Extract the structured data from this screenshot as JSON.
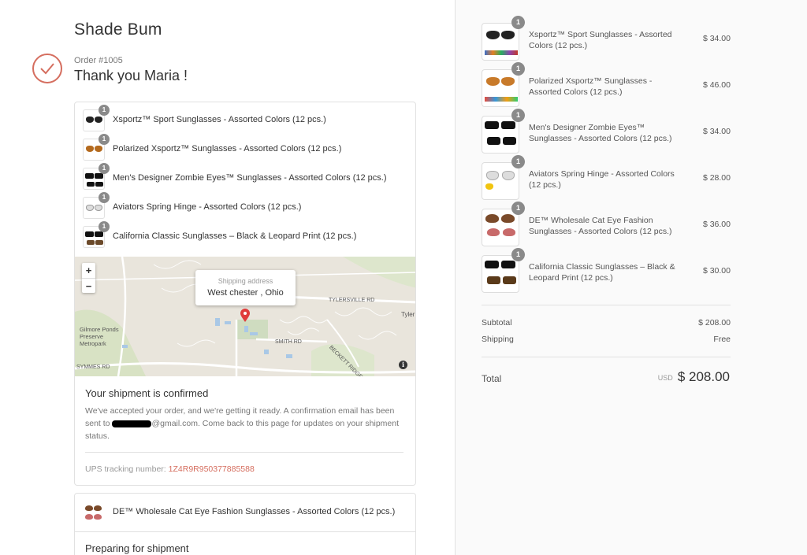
{
  "shop": {
    "name": "Shade Bum"
  },
  "order": {
    "number": "Order #1005",
    "thank_you": "Thank you Maria !"
  },
  "fulfilled_items": [
    {
      "name": "Xsportz™ Sport Sunglasses - Assorted Colors (12 pcs.)",
      "qty": "1"
    },
    {
      "name": "Polarized Xsportz™ Sunglasses - Assorted Colors (12 pcs.)",
      "qty": "1"
    },
    {
      "name": "Men's Designer Zombie Eyes™ Sunglasses - Assorted Colors (12 pcs.)",
      "qty": "1"
    },
    {
      "name": "Aviators Spring Hinge - Assorted Colors (12 pcs.)",
      "qty": "1"
    },
    {
      "name": "California Classic Sunglasses – Black & Leopard Print (12 pcs.)",
      "qty": "1"
    }
  ],
  "map": {
    "zoom_in": "+",
    "zoom_out": "−",
    "popup_label": "Shipping address",
    "popup_address": "West chester , Ohio",
    "info": "i",
    "labels": {
      "park": "Gilmore Ponds\nPreserve\nMetropark",
      "tylersville": "TYLERSVILLE RD",
      "tyler": "Tyler",
      "smith": "SMITH RD",
      "beckett": "BECKETT RIDGE BLVD",
      "symmes": "SYMMES RD"
    }
  },
  "shipment": {
    "title": "Your shipment is confirmed",
    "text_before": "We've accepted your order, and we're getting it ready. A confirmation email has been sent to ",
    "email_suffix": "@gmail.com",
    "text_after": ". Come back to this page for updates on your shipment status.",
    "tracking_label": "UPS tracking number: ",
    "tracking_number": "1Z4R9R950377885588"
  },
  "pending": {
    "item": {
      "name": "DE™ Wholesale Cat Eye Fashion Sunglasses - Assorted Colors (12 pcs.)",
      "qty": "1"
    },
    "title": "Preparing for shipment"
  },
  "summary": {
    "items": [
      {
        "name": "Xsportz™ Sport Sunglasses - Assorted Colors (12 pcs.)",
        "qty": "1",
        "price": "$ 34.00"
      },
      {
        "name": "Polarized Xsportz™ Sunglasses - Assorted Colors (12 pcs.)",
        "qty": "1",
        "price": "$ 46.00"
      },
      {
        "name": "Men's Designer Zombie Eyes™ Sunglasses - Assorted Colors (12 pcs.)",
        "qty": "1",
        "price": "$ 34.00"
      },
      {
        "name": "Aviators Spring Hinge - Assorted Colors (12 pcs.)",
        "qty": "1",
        "price": "$ 28.00"
      },
      {
        "name": "DE™ Wholesale Cat Eye Fashion Sunglasses - Assorted Colors (12 pcs.)",
        "qty": "1",
        "price": "$ 36.00"
      },
      {
        "name": "California Classic Sunglasses – Black & Leopard Print (12 pcs.)",
        "qty": "1",
        "price": "$ 30.00"
      }
    ],
    "subtotal_label": "Subtotal",
    "subtotal_value": "$ 208.00",
    "shipping_label": "Shipping",
    "shipping_value": "Free",
    "total_label": "Total",
    "total_currency": "USD",
    "total_value": "$ 208.00"
  },
  "colors": {
    "accent": "#d56e5f",
    "badge": "#8a8a8a",
    "sidebar_bg": "#fafafa"
  }
}
